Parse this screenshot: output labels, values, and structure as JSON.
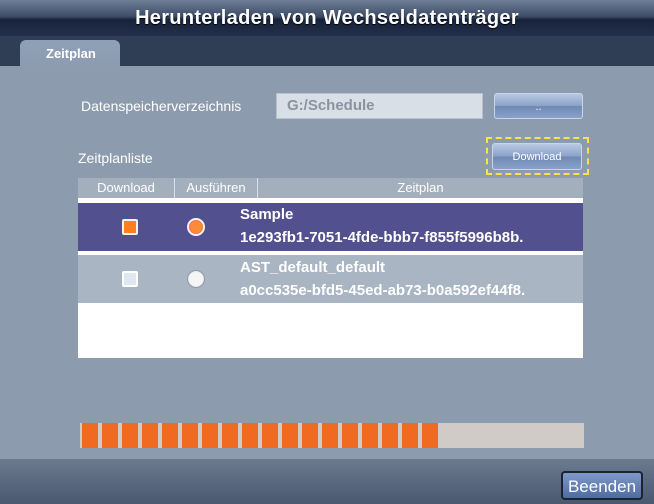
{
  "window": {
    "title": "Herunterladen von Wechseldatenträger"
  },
  "tabs": [
    {
      "label": "Zeitplan"
    }
  ],
  "storage": {
    "label": "Datenspeicherverzeichnis",
    "value": "G:/Schedule",
    "browse_label": ".."
  },
  "schedule_list": {
    "label": "Zeitplanliste",
    "download_label": "Download"
  },
  "table": {
    "headers": [
      "Download",
      "Ausführen",
      "Zeitplan"
    ],
    "rows": [
      {
        "name": "Sample",
        "id": "1e293fb1-7051-4fde-bbb7-f855f5996b8b.",
        "download_checked": true,
        "execute_selected": true
      },
      {
        "name": "AST_default_default",
        "id": "a0cc535e-bfd5-45ed-ab73-b0a592ef44f8.",
        "download_checked": false,
        "execute_selected": false
      }
    ]
  },
  "progress": {
    "value": 0.72
  },
  "footer": {
    "end_label": "Beenden"
  },
  "colors": {
    "accent": "#f06b21",
    "selection": "#53508f",
    "highlight_border": "#ffe14a"
  }
}
